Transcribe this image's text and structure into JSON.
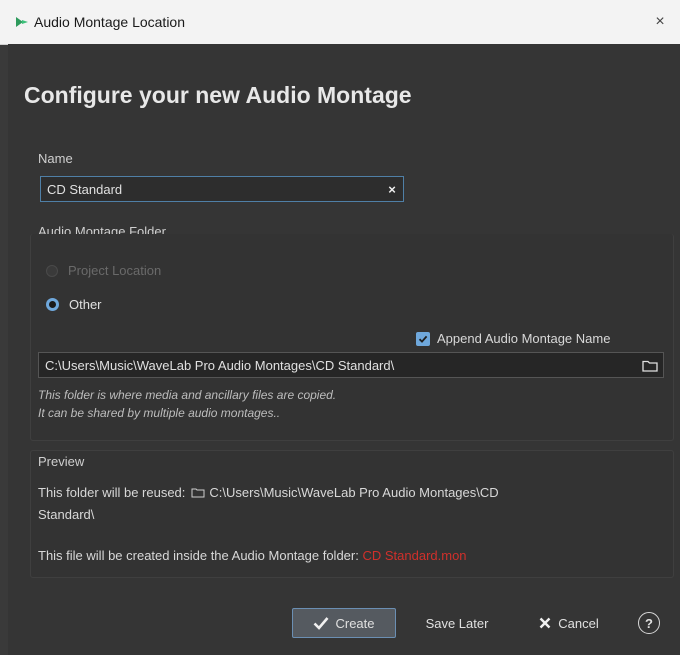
{
  "window": {
    "title": "Audio Montage Location",
    "close_label": "×"
  },
  "heading": "Configure your new Audio Montage",
  "name_section": {
    "label": "Name",
    "value": "CD Standard",
    "clear_label": "×"
  },
  "folder_section": {
    "label": "Audio Montage Folder",
    "options": [
      {
        "label": "Project Location",
        "selected": false,
        "enabled": false
      },
      {
        "label": "Other",
        "selected": true,
        "enabled": true
      }
    ],
    "append_label": "Append Audio Montage Name",
    "append_checked": true,
    "path": "C:\\Users\\Music\\WaveLab Pro Audio Montages\\CD Standard\\",
    "note_line1": "This folder is where media and ancillary files are copied.",
    "note_line2": "It can be shared by multiple audio montages.."
  },
  "preview": {
    "label": "Preview",
    "reuse_prefix": "This folder will be reused:",
    "reuse_path_line1": "C:\\Users\\Music\\WaveLab Pro Audio Montages\\CD",
    "reuse_path_line2": "Standard\\",
    "file_prefix": "This file will be created inside the Audio Montage folder:",
    "file_name": "CD Standard.mon"
  },
  "buttons": {
    "create": "Create",
    "save_later": "Save Later",
    "cancel": "Cancel",
    "help": "?"
  },
  "colors": {
    "accent": "#6fa8dc",
    "filename_red": "#d0302b"
  }
}
